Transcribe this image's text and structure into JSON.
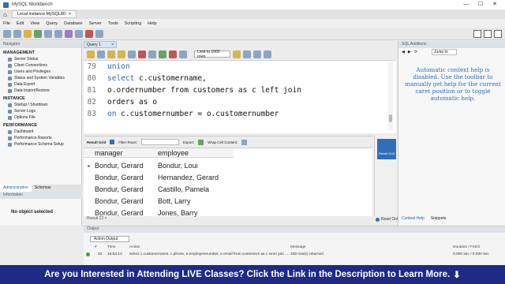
{
  "window": {
    "title": "MySQL Workbench",
    "minimize": "—",
    "maximize": "☐",
    "close": "✕"
  },
  "connection_tab": {
    "label": "Local instance MySQL80",
    "close": "×"
  },
  "menu": [
    "File",
    "Edit",
    "View",
    "Query",
    "Database",
    "Server",
    "Tools",
    "Scripting",
    "Help"
  ],
  "navigator": {
    "header": "Navigator",
    "management": {
      "title": "MANAGEMENT",
      "items": [
        "Server Status",
        "Client Connections",
        "Users and Privileges",
        "Status and System Variables",
        "Data Export",
        "Data Import/Restore"
      ]
    },
    "instance": {
      "title": "INSTANCE",
      "items": [
        "Startup / Shutdown",
        "Server Logs",
        "Options File"
      ]
    },
    "performance": {
      "title": "PERFORMANCE",
      "items": [
        "Dashboard",
        "Performance Reports",
        "Performance Schema Setup"
      ]
    },
    "tabs": [
      "Administration",
      "Schemas"
    ],
    "info_header": "Information",
    "no_object": "No object selected"
  },
  "query_tab": {
    "label": "Query 1",
    "close": "×"
  },
  "query_toolbar": {
    "limit": "Limit to 1000 rows"
  },
  "editor": {
    "lines": [
      {
        "num": "79",
        "kw": "union",
        "text": ""
      },
      {
        "num": "80",
        "kw": "select",
        "text": " c.customername,"
      },
      {
        "num": "81",
        "kw": "",
        "text": "o.ordernumber from customers as c left join"
      },
      {
        "num": "82",
        "kw": "",
        "text": "orders as o"
      },
      {
        "num": "83",
        "kw": "on",
        "text": " c.customernumber = o.customernumber"
      }
    ]
  },
  "result_toolbar": {
    "grid_label": "Result Grid",
    "filter_label": "Filter Rows:",
    "export_label": "Export:",
    "wrap_label": "Wrap Cell Content:"
  },
  "results": {
    "columns": [
      "manager",
      "employee"
    ],
    "rows": [
      [
        "Bondur, Gerard",
        "Bondur, Loui"
      ],
      [
        "Bondur, Gerard",
        "Hernandez, Gerard"
      ],
      [
        "Bondur, Gerard",
        "Castillo, Pamela"
      ],
      [
        "Bondur, Gerard",
        "Bott, Larry"
      ],
      [
        "Bondur, Gerard",
        "Jones, Barry"
      ]
    ],
    "row_marker": "▸",
    "side_button": "Result Grid",
    "result_tab": "Result 22 ×",
    "read_only": "Read Only"
  },
  "sql_additions": {
    "header": "SQL Additions",
    "jump_to": "Jump to",
    "help_text": "Automatic context help is disabled. Use the toolbar to manually get help for the current caret position or to toggle automatic help.",
    "tabs": [
      "Context Help",
      "Snippets"
    ]
  },
  "output": {
    "header": "Output",
    "select": "Action Output",
    "columns": {
      "num": "#",
      "time": "Time",
      "action": "Action",
      "message": "Message",
      "duration": "Duration / Fetch"
    },
    "row": {
      "num": "32",
      "time": "15:54:13",
      "action": "select c.customername, c.phone, e.employeenumber, e.email from customers as c inner join ...",
      "message": "338 row(s) returned",
      "duration": "0.000 sec / 0.000 sec"
    }
  },
  "banner": {
    "text": "Are you Interested in Attending LIVE Classes? Click the Link in the Description to Learn More.",
    "arrow": "⬇"
  },
  "colors": {
    "accent": "#2f6fb8",
    "banner_bg": "#1d2b86",
    "keyword": "#2a6ab3"
  }
}
